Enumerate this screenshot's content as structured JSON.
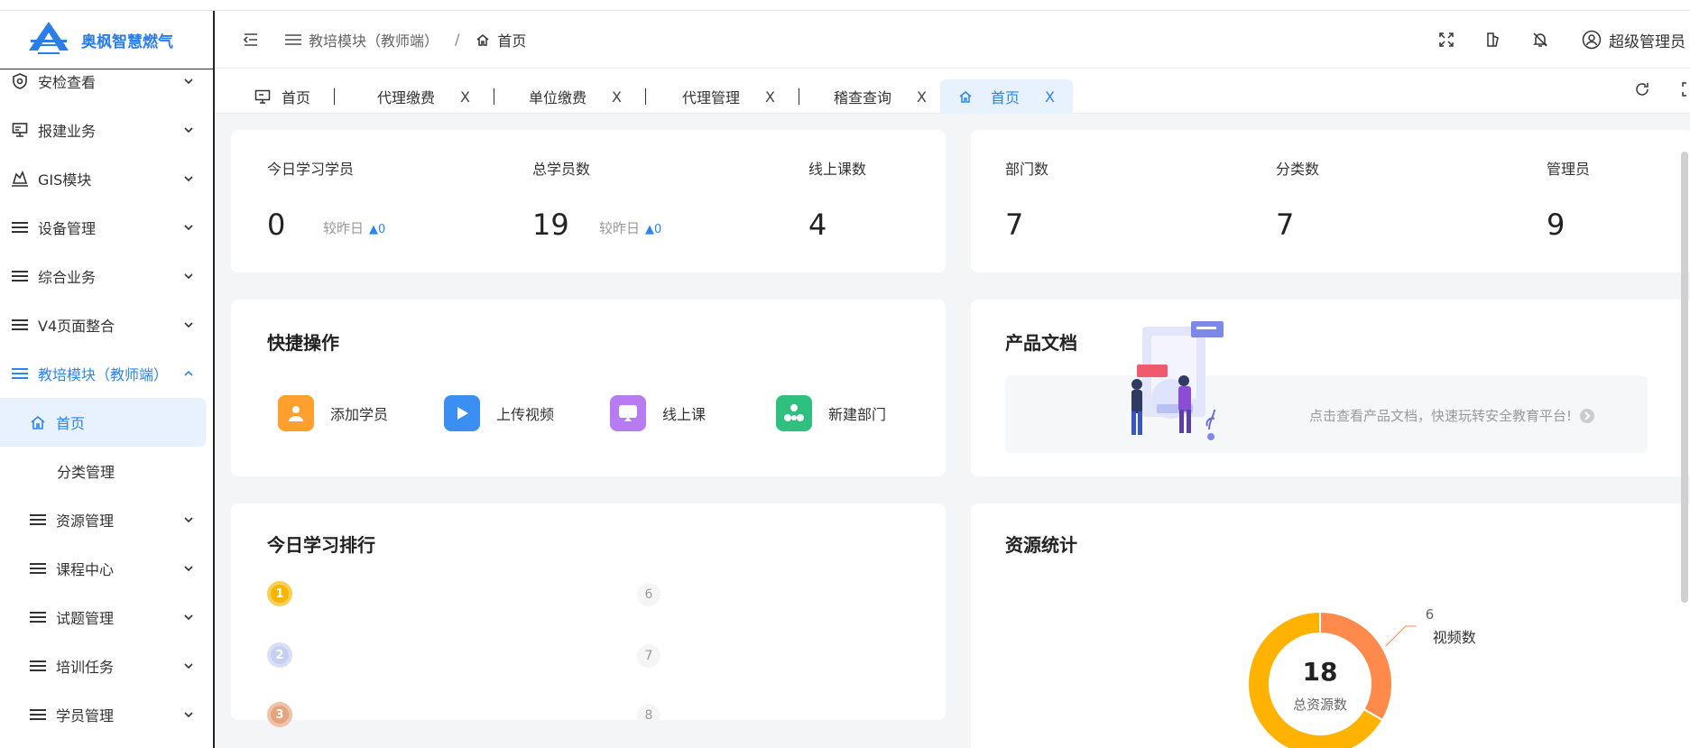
{
  "brand": {
    "name": "奥枫智慧燃气",
    "color": "#2b7de9"
  },
  "sidebar": {
    "items": [
      {
        "label": "安检查看",
        "icon": "shield-icon",
        "level": 0
      },
      {
        "label": "报建业务",
        "icon": "monitor-icon",
        "level": 0
      },
      {
        "label": "GIS模块",
        "icon": "map-icon",
        "level": 0
      },
      {
        "label": "设备管理",
        "icon": "menu-icon",
        "level": 0
      },
      {
        "label": "综合业务",
        "icon": "menu-icon",
        "level": 0
      },
      {
        "label": "V4页面整合",
        "icon": "menu-icon",
        "level": 0
      },
      {
        "label": "教培模块（教师端）",
        "icon": "menu-icon",
        "level": 0,
        "open": true
      },
      {
        "label": "首页",
        "icon": "home-icon",
        "level": 1,
        "active": true
      },
      {
        "label": "分类管理",
        "icon": "",
        "level": 2
      },
      {
        "label": "资源管理",
        "icon": "menu-icon",
        "level": 1
      },
      {
        "label": "课程中心",
        "icon": "menu-icon",
        "level": 1
      },
      {
        "label": "试题管理",
        "icon": "menu-icon",
        "level": 1
      },
      {
        "label": "培训任务",
        "icon": "menu-icon",
        "level": 1
      },
      {
        "label": "学员管理",
        "icon": "menu-icon",
        "level": 1
      }
    ]
  },
  "header": {
    "breadcrumb": [
      "教培模块（教师端）",
      "首页"
    ],
    "breadcrumb_sep": "/",
    "user": "超级管理员"
  },
  "tabs": [
    {
      "label": "首页",
      "icon": "monitor-icon",
      "closable": false
    },
    {
      "label": "代理缴费",
      "closable": true
    },
    {
      "label": "单位缴费",
      "closable": true
    },
    {
      "label": "代理管理",
      "closable": true
    },
    {
      "label": "稽查查询",
      "closable": true
    },
    {
      "label": "首页",
      "icon": "home-icon",
      "closable": true,
      "active": true
    }
  ],
  "tab_close": "X",
  "stats_left": {
    "today_label": "今日学习学员",
    "today_value": "0",
    "today_cmp": "较昨日",
    "today_delta": "▲0",
    "total_label": "总学员数",
    "total_value": "19",
    "total_cmp": "较昨日",
    "total_delta": "▲0",
    "courses_label": "线上课数",
    "courses_value": "4"
  },
  "stats_right": {
    "dept_label": "部门数",
    "dept_value": "7",
    "cat_label": "分类数",
    "cat_value": "7",
    "admin_label": "管理员",
    "admin_value": "9"
  },
  "quick": {
    "title": "快捷操作",
    "items": [
      {
        "label": "添加学员",
        "color": "#ff9f2e"
      },
      {
        "label": "上传视频",
        "color": "#3b8ff3"
      },
      {
        "label": "线上课",
        "color": "#b77cf2"
      },
      {
        "label": "新建部门",
        "color": "#2fbf7f"
      }
    ]
  },
  "docs": {
    "title": "产品文档",
    "text": "点击查看产品文档，快速玩转安全教育平台!"
  },
  "ranking": {
    "title": "今日学习排行",
    "rows": [
      {
        "rank": "1",
        "count": "6",
        "color": "#f7b500"
      },
      {
        "rank": "2",
        "count": "7",
        "color": "#c5cff0"
      },
      {
        "rank": "3",
        "count": "8",
        "color": "#e6a47c"
      }
    ]
  },
  "resources": {
    "title": "资源统计",
    "total_value": "18",
    "total_label": "总资源数"
  },
  "chart_data": {
    "type": "pie",
    "categories": [
      "视频数",
      ""
    ],
    "values": [
      6,
      12
    ],
    "colors": [
      "#ff8a4c",
      "#ffb300"
    ]
  }
}
